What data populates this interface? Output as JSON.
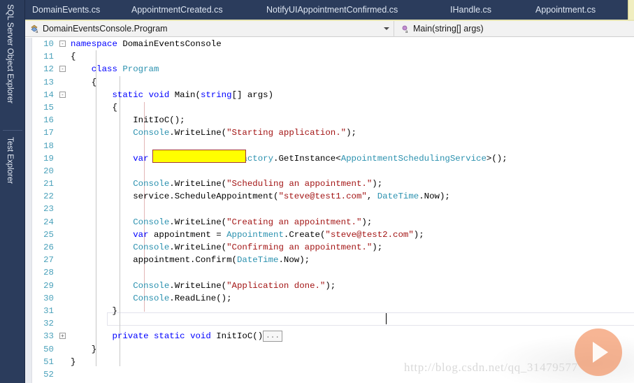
{
  "sidebar": {
    "tabs": [
      {
        "label": "SQL Server Object Explorer"
      },
      {
        "label": "Test Explorer"
      }
    ]
  },
  "tabstrip": {
    "tabs": [
      {
        "label": "DomainEvents.cs"
      },
      {
        "label": "AppointmentCreated.cs"
      },
      {
        "label": "NotifyUIAppointmentConfirmed.cs"
      },
      {
        "label": "IHandle.cs"
      },
      {
        "label": "Appointment.cs"
      }
    ]
  },
  "navbar": {
    "type_label": "DomainEventsConsole.Program",
    "member_label": "Main(string[] args)"
  },
  "editor": {
    "lines": [
      {
        "num": "10",
        "fold": "-",
        "indent": 0,
        "text": "namespace DomainEventsConsole"
      },
      {
        "num": "11",
        "fold": "",
        "indent": 0,
        "text": "{"
      },
      {
        "num": "12",
        "fold": "-",
        "indent": 1,
        "text": "class Program"
      },
      {
        "num": "13",
        "fold": "",
        "indent": 1,
        "text": "{"
      },
      {
        "num": "14",
        "fold": "-",
        "indent": 2,
        "text": "static void Main(string[] args)"
      },
      {
        "num": "15",
        "fold": "",
        "indent": 2,
        "text": "{"
      },
      {
        "num": "16",
        "fold": "",
        "indent": 3,
        "text": "InitIoC();"
      },
      {
        "num": "17",
        "fold": "",
        "indent": 3,
        "text": "Console.WriteLine(\"Starting application.\");"
      },
      {
        "num": "18",
        "fold": "",
        "indent": 3,
        "text": ""
      },
      {
        "num": "19",
        "fold": "",
        "indent": 3,
        "text": "var service = ObjectFactory.GetInstance<AppointmentSchedulingService>();"
      },
      {
        "num": "20",
        "fold": "",
        "indent": 3,
        "text": ""
      },
      {
        "num": "21",
        "fold": "",
        "indent": 3,
        "text": "Console.WriteLine(\"Scheduling an appointment.\");"
      },
      {
        "num": "22",
        "fold": "",
        "indent": 3,
        "text": "service.ScheduleAppointment(\"steve@test1.com\", DateTime.Now);"
      },
      {
        "num": "23",
        "fold": "",
        "indent": 3,
        "text": ""
      },
      {
        "num": "24",
        "fold": "",
        "indent": 3,
        "text": "Console.WriteLine(\"Creating an appointment.\");"
      },
      {
        "num": "25",
        "fold": "",
        "indent": 3,
        "text": "var appointment = Appointment.Create(\"steve@test2.com\");"
      },
      {
        "num": "26",
        "fold": "",
        "indent": 3,
        "text": "Console.WriteLine(\"Confirming an appointment.\");"
      },
      {
        "num": "27",
        "fold": "",
        "indent": 3,
        "text": "appointment.Confirm(DateTime.Now);"
      },
      {
        "num": "28",
        "fold": "",
        "indent": 3,
        "text": ""
      },
      {
        "num": "29",
        "fold": "",
        "indent": 3,
        "text": "Console.WriteLine(\"Application done.\");"
      },
      {
        "num": "30",
        "fold": "",
        "indent": 3,
        "text": "Console.ReadLine();"
      },
      {
        "num": "31",
        "fold": "",
        "indent": 2,
        "text": "}"
      },
      {
        "num": "32",
        "fold": "",
        "indent": 2,
        "text": ""
      },
      {
        "num": "33",
        "fold": "+",
        "indent": 2,
        "text": "private static void InitIoC()..."
      },
      {
        "num": "50",
        "fold": "",
        "indent": 1,
        "text": "}"
      },
      {
        "num": "51",
        "fold": "",
        "indent": 0,
        "text": "}"
      },
      {
        "num": "52",
        "fold": "",
        "indent": 0,
        "text": ""
      }
    ],
    "collapsed_placeholder": "...",
    "highlighted_line": "16",
    "current_line": "29"
  },
  "overlay": {
    "watermark": "http://blog.csdn.net/qq_31479577",
    "play_button": "play-icon"
  },
  "colors": {
    "chrome": "#2b3c5c",
    "accent_tab": "#f0eec0",
    "highlight": "#ffff00",
    "keyword": "#0000ff",
    "type": "#2b91af",
    "string": "#a31515",
    "play": "#f0783c"
  }
}
